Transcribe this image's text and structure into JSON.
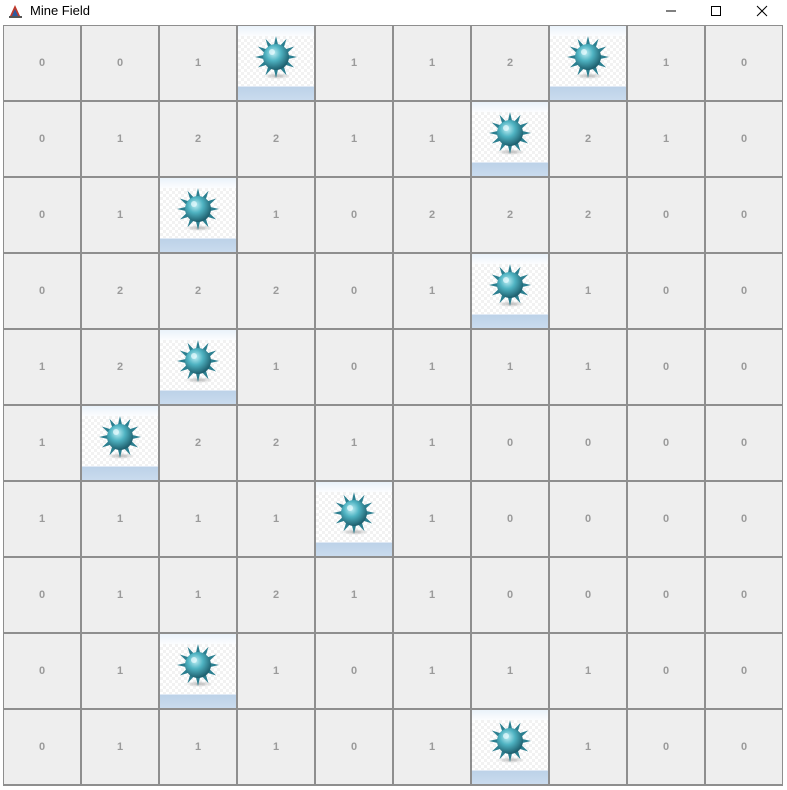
{
  "window": {
    "title": "Mine Field"
  },
  "board": {
    "rows": [
      [
        "0",
        "0",
        "1",
        "mine",
        "1",
        "1",
        "2",
        "mine",
        "1",
        "0"
      ],
      [
        "0",
        "1",
        "2",
        "2",
        "1",
        "1",
        "mine",
        "2",
        "1",
        "0"
      ],
      [
        "0",
        "1",
        "mine",
        "1",
        "0",
        "2",
        "2",
        "2",
        "0",
        "0"
      ],
      [
        "0",
        "2",
        "2",
        "2",
        "0",
        "1",
        "mine",
        "1",
        "0",
        "0"
      ],
      [
        "1",
        "2",
        "mine",
        "1",
        "0",
        "1",
        "1",
        "1",
        "0",
        "0"
      ],
      [
        "1",
        "mine",
        "2",
        "2",
        "1",
        "1",
        "0",
        "0",
        "0",
        "0"
      ],
      [
        "1",
        "1",
        "1",
        "1",
        "mine",
        "1",
        "0",
        "0",
        "0",
        "0"
      ],
      [
        "0",
        "1",
        "1",
        "2",
        "1",
        "1",
        "0",
        "0",
        "0",
        "0"
      ],
      [
        "0",
        "1",
        "mine",
        "1",
        "0",
        "1",
        "1",
        "1",
        "0",
        "0"
      ],
      [
        "0",
        "1",
        "1",
        "1",
        "0",
        "1",
        "mine",
        "1",
        "0",
        "0"
      ]
    ]
  },
  "icons": {
    "mine": "mine-icon",
    "app": "java-app-icon"
  },
  "colors": {
    "cell": "#eeeeee",
    "number": "#9a9a9a",
    "mine": "#3aa0b0",
    "grid_line": "#8e8e8e"
  }
}
